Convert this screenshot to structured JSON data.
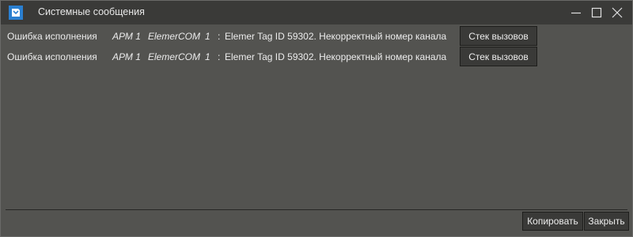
{
  "window": {
    "title": "Системные сообщения",
    "icon": "app-logo-icon",
    "controls": [
      "minimize-icon",
      "maximize-icon",
      "close-icon"
    ]
  },
  "messages": [
    {
      "type": "Ошибка исполнения",
      "workstation": "АРМ 1",
      "component": "ElemerCOM",
      "number": "1",
      "separator": ":",
      "text": "Elemer Tag ID 59302.  Некорректный номер канала",
      "button_label": "Стек вызовов"
    },
    {
      "type": "Ошибка исполнения",
      "workstation": "АРМ 1",
      "component": "ElemerCOM",
      "number": "1",
      "separator": ":",
      "text": "Elemer Tag ID 59302.  Некорректный номер канала",
      "button_label": "Стек вызовов"
    }
  ],
  "footer": {
    "copy_label": "Копировать",
    "close_label": "Закрыть"
  },
  "colors": {
    "background": "#535350",
    "titlebar": "#3a3a38",
    "button": "#3a3a38",
    "text": "#ececec",
    "icon_accent": "#2a7fd0"
  }
}
